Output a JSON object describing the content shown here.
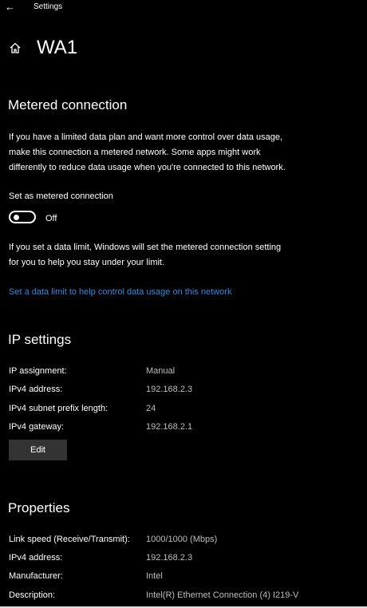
{
  "app": {
    "title": "Settings"
  },
  "page": {
    "title": "WA1"
  },
  "metered": {
    "heading": "Metered connection",
    "description_lines": [
      "If you have a limited data plan and want more control over data usage,",
      "make this connection a metered network. Some apps might work",
      "differently to reduce data usage when you're connected to this network."
    ],
    "toggle_label": "Set as metered connection",
    "toggle_state": "Off",
    "limit_note_lines": [
      "If you set a data limit, Windows will set the metered connection setting",
      "for you to help you stay under your limit."
    ],
    "limit_link": "Set a data limit to help control data usage on this network"
  },
  "ip": {
    "heading": "IP settings",
    "rows": [
      {
        "label": "IP assignment:",
        "value": "Manual"
      },
      {
        "label": "IPv4 address:",
        "value": "192.168.2.3"
      },
      {
        "label": "IPv4 subnet prefix length:",
        "value": "24"
      },
      {
        "label": "IPv4 gateway:",
        "value": "192.168.2.1"
      }
    ],
    "edit_label": "Edit"
  },
  "properties": {
    "heading": "Properties",
    "rows": [
      {
        "label": "Link speed (Receive/Transmit):",
        "value": "1000/1000 (Mbps)"
      },
      {
        "label": "IPv4 address:",
        "value": "192.168.2.3"
      },
      {
        "label": "Manufacturer:",
        "value": "Intel"
      },
      {
        "label": "Description:",
        "value": "Intel(R) Ethernet Connection (4) I219-V"
      }
    ]
  },
  "colors": {
    "link": "#2f8ae3",
    "value_text": "#bdbdbd",
    "button_bg": "#333333"
  },
  "icons": {
    "back": "back-arrow-icon",
    "home": "home-icon"
  }
}
